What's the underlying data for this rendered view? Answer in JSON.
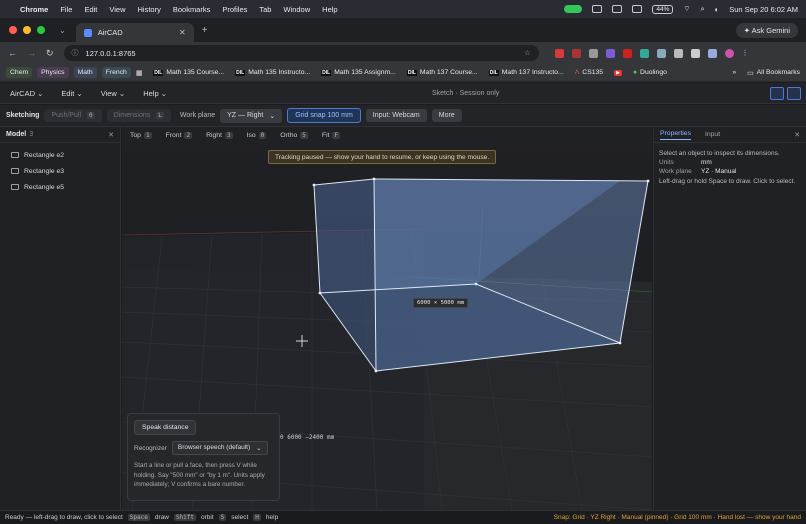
{
  "menubar": {
    "app": "Chrome",
    "items": [
      "File",
      "Edit",
      "View",
      "History",
      "Bookmarks",
      "Profiles",
      "Tab",
      "Window",
      "Help"
    ],
    "battery": "44%",
    "datetime": "Sun Sep 20  6:02 AM"
  },
  "browser": {
    "tab_title": "AirCAD",
    "url": "127.0.0.1:8765",
    "gemini_label": "Ask Gemini",
    "bookmarks": [
      {
        "label": "Chem",
        "color": "#3c4a3c"
      },
      {
        "label": "Physics",
        "color": "#4a3a52"
      },
      {
        "label": "Math",
        "color": "#3a4658"
      },
      {
        "label": "French",
        "color": "#3a4a52"
      }
    ],
    "bookmark_links": [
      "Math 135 Course...",
      "Math 135 Instructo...",
      "Math 135 Assignm...",
      "Math 137 Course...",
      "Math 137 Instructo...",
      "CS135",
      "Duolingo"
    ],
    "all_bookmarks": "All Bookmarks"
  },
  "app": {
    "menus": [
      "AirCAD",
      "Edit",
      "View",
      "Help"
    ],
    "session": "Sketch · Session only"
  },
  "toolbar": {
    "mode": "Sketching",
    "push_pull": "Push/Pull",
    "push_pull_key": "0",
    "dimensions": "Dimensions",
    "dimensions_key": "L",
    "work_plane_label": "Work plane",
    "work_plane_value": "YZ — Right",
    "grid_snap": "Grid snap  100 mm",
    "input": "Input: Webcam",
    "more": "More"
  },
  "model": {
    "title": "Model",
    "count": "3",
    "items": [
      "Rectangle e2",
      "Rectangle e3",
      "Rectangle e5"
    ]
  },
  "viewport": {
    "views": [
      {
        "label": "Top",
        "key": "1"
      },
      {
        "label": "Front",
        "key": "2"
      },
      {
        "label": "Right",
        "key": "3"
      },
      {
        "label": "Iso",
        "key": "0"
      },
      {
        "label": "Ortho",
        "key": "5"
      },
      {
        "label": "Fit",
        "key": "F"
      }
    ],
    "hint": "Tracking paused — show your hand to resume, or keep using the mouse.",
    "dimension_label": "6000 × 5000 mm",
    "coord_label": "0 6000 −2400 mm",
    "speak_button": "Speak distance",
    "recognizer_label": "Recognizer",
    "recognizer_value": "Browser speech (default)",
    "speak_help": "Start a line or pull a face, then press V while holding. Say \"500 mm\" or \"by 1 m\". Units apply immediately; V confirms a bare number."
  },
  "inspector": {
    "tabs": [
      "Properties",
      "Input"
    ],
    "intro": "Select an object to inspect its dimensions.",
    "units_label": "Units",
    "units_value": "mm",
    "plane_label": "Work plane",
    "plane_value": "YZ · Manual",
    "help": "Left-drag or hold Space to draw. Click to select."
  },
  "status": {
    "ready": "Ready — left-drag to draw, click to select",
    "hints": [
      {
        "key": "Space",
        "label": "draw"
      },
      {
        "key": "Shift",
        "label": "orbit"
      },
      {
        "key": "S",
        "label": "select"
      },
      {
        "key": "H",
        "label": "help"
      }
    ],
    "right": "Snap: Grid · YZ Right · Manual (pinned) · Grid 100 mm · Hand lost — show your hand"
  },
  "colors": {
    "accent": "#4c7bd1",
    "warning": "#e0a23a",
    "box_edge": "#dfe7f5"
  }
}
